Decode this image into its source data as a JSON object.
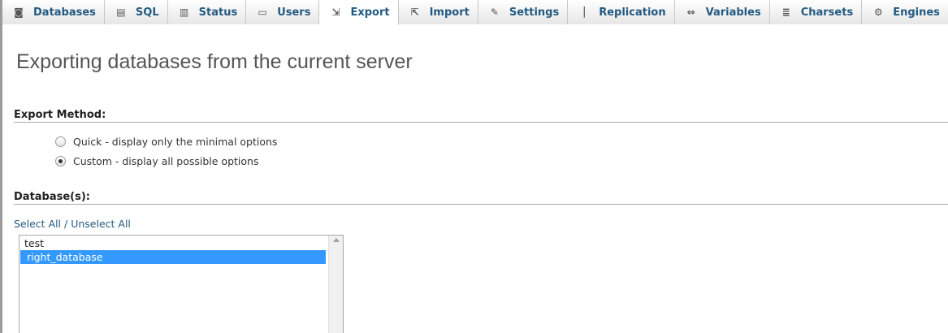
{
  "tabs": [
    {
      "label": "Databases",
      "icon": "database-icon",
      "glyph": "◙",
      "active": false
    },
    {
      "label": "SQL",
      "icon": "sql-icon",
      "glyph": "▤",
      "active": false
    },
    {
      "label": "Status",
      "icon": "status-icon",
      "glyph": "▥",
      "active": false
    },
    {
      "label": "Users",
      "icon": "users-icon",
      "glyph": "▭",
      "active": false
    },
    {
      "label": "Export",
      "icon": "export-icon",
      "glyph": "⇲",
      "active": true
    },
    {
      "label": "Import",
      "icon": "import-icon",
      "glyph": "⇱",
      "active": false
    },
    {
      "label": "Settings",
      "icon": "wrench-icon",
      "glyph": "✎",
      "active": false
    },
    {
      "label": "Replication",
      "icon": "replication-icon",
      "glyph": "⏐",
      "active": false
    },
    {
      "label": "Variables",
      "icon": "variables-icon",
      "glyph": "⇔",
      "active": false
    },
    {
      "label": "Charsets",
      "icon": "charsets-icon",
      "glyph": "≣",
      "active": false
    },
    {
      "label": "Engines",
      "icon": "engines-icon",
      "glyph": "⚙",
      "active": false
    }
  ],
  "page_title": "Exporting databases from the current server",
  "export_method": {
    "header": "Export Method:",
    "options": [
      {
        "label": "Quick - display only the minimal options",
        "checked": false
      },
      {
        "label": "Custom - display all possible options",
        "checked": true
      }
    ]
  },
  "databases": {
    "header": "Database(s):",
    "select_all": "Select All",
    "separator": " / ",
    "unselect_all": "Unselect All",
    "items": [
      {
        "name": "test",
        "selected": false
      },
      {
        "name": "right_database",
        "selected": true
      }
    ]
  },
  "colors": {
    "link": "#235a81",
    "selection": "#3399ff"
  }
}
